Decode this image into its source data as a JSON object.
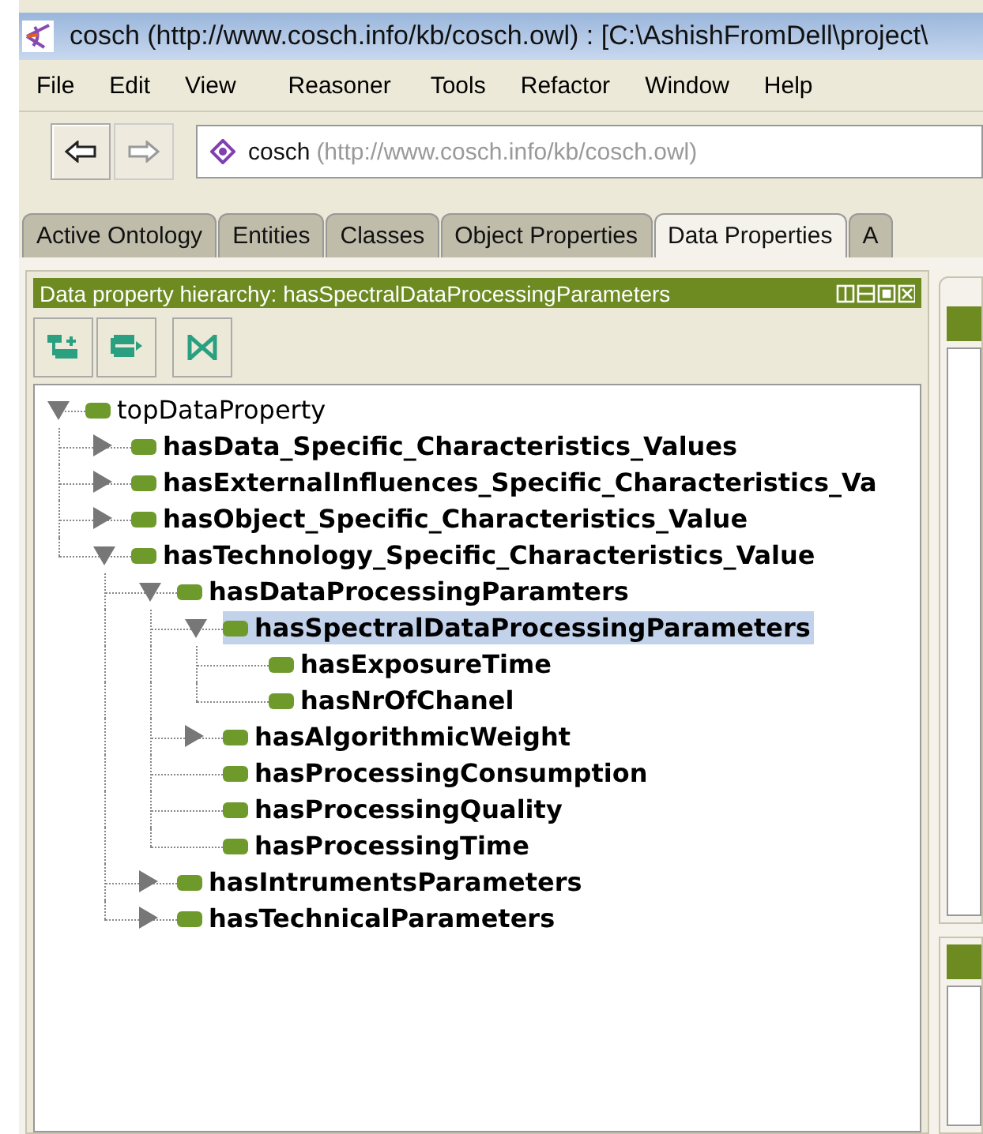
{
  "window": {
    "title": "cosch (http://www.cosch.info/kb/cosch.owl)  : [C:\\AshishFromDell\\project\\"
  },
  "menu": [
    "File",
    "Edit",
    "View",
    "Reasoner",
    "Tools",
    "Refactor",
    "Window",
    "Help"
  ],
  "address": {
    "name": "cosch",
    "iri": "(http://www.cosch.info/kb/cosch.owl)"
  },
  "tabs": [
    {
      "label": "Active Ontology",
      "selected": false
    },
    {
      "label": "Entities",
      "selected": false
    },
    {
      "label": "Classes",
      "selected": false
    },
    {
      "label": "Object Properties",
      "selected": false
    },
    {
      "label": "Data Properties",
      "selected": true
    },
    {
      "label": "A",
      "selected": false
    }
  ],
  "panel": {
    "title": "Data property hierarchy: hasSpectralDataProcessingParameters"
  },
  "tree": {
    "label": "topDataProperty",
    "expanded": true,
    "selected": false,
    "children": [
      {
        "label": "hasData_Specific_Characteristics_Values",
        "expanded": false,
        "selected": false
      },
      {
        "label": "hasExternalInfluences_Specific_Characteristics_Va",
        "expanded": false,
        "selected": false
      },
      {
        "label": "hasObject_Specific_Characteristics_Value",
        "expanded": false,
        "selected": false
      },
      {
        "label": "hasTechnology_Specific_Characteristics_Value",
        "expanded": true,
        "selected": false,
        "children": [
          {
            "label": "hasDataProcessingParamters",
            "expanded": true,
            "selected": false,
            "children": [
              {
                "label": "hasSpectralDataProcessingParameters",
                "expanded": true,
                "selected": true,
                "children": [
                  {
                    "label": "hasExposureTime",
                    "selected": false
                  },
                  {
                    "label": "hasNrOfChanel",
                    "selected": false
                  }
                ]
              },
              {
                "label": "hasAlgorithmicWeight",
                "expanded": false,
                "selected": false
              },
              {
                "label": "hasProcessingConsumption",
                "selected": false
              },
              {
                "label": "hasProcessingQuality",
                "selected": false
              },
              {
                "label": "hasProcessingTime",
                "selected": false
              }
            ]
          },
          {
            "label": "hasIntrumentsParameters",
            "expanded": false,
            "selected": false
          },
          {
            "label": "hasTechnicalParameters",
            "expanded": false,
            "selected": false
          }
        ]
      }
    ]
  }
}
